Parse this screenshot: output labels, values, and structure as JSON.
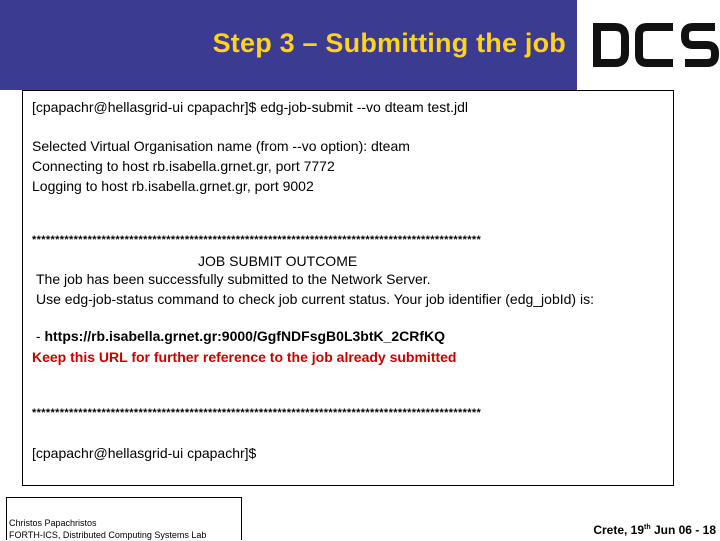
{
  "header": {
    "title": "Step 3 – Submitting the job",
    "logo_text": "DCS",
    "background_color": "#3b3b91",
    "title_color": "#ffd21c"
  },
  "terminal": {
    "command": "[cpapachr@hellasgrid-ui cpapachr]$ edg-job-submit --vo dteam test.jdl",
    "output_lines": [
      "Selected Virtual Organisation name (from --vo option): dteam",
      "Connecting to host rb.isabella.grnet.gr, port 7772",
      "Logging to host rb.isabella.grnet.gr, port 9002"
    ],
    "separator": "*************************************************************************************************",
    "outcome_title": "JOB SUBMIT OUTCOME",
    "outcome_line1": "The job has been successfully submitted to the Network Server.",
    "outcome_line2": "Use edg-job-status command to check job current status. Your job identifier (edg_jobId) is:",
    "job_dash": " - ",
    "job_url": "https://rb.isabella.grnet.gr:9000/GgfNDFsgB0L3btK_2CRfKQ",
    "keep_note": "Keep this URL for further reference to the job already submitted",
    "prompt": "[cpapachr@hellasgrid-ui cpapachr]$"
  },
  "footer": {
    "author": "Christos Papachristos",
    "affiliation": "FORTH-ICS, Distributed Computing Systems Lab",
    "location_prefix": "Crete, 19",
    "date_sup": "th",
    "date_rest": " Jun 06  - 18"
  }
}
